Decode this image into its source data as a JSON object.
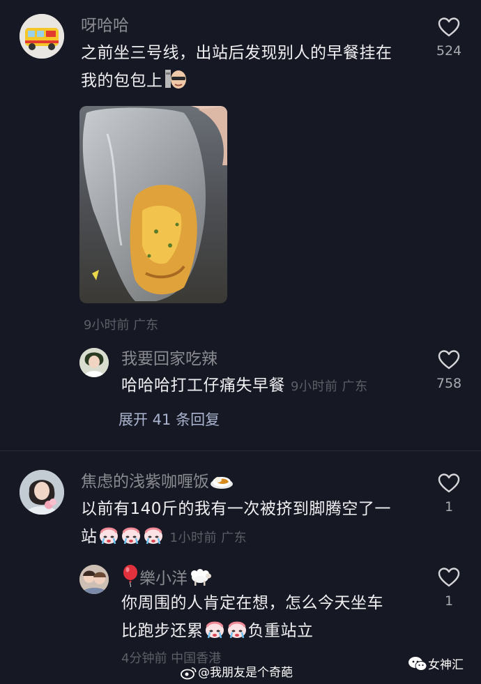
{
  "comments": [
    {
      "username": "呀哈哈",
      "text_lines": [
        "之前坐三号线，出站后发现别人的早餐挂在",
        "我的包包上"
      ],
      "time_location": "9小时前 广东",
      "likes": "524"
    },
    {
      "username": "焦虑的浅紫咖喱饭",
      "text_lines": [
        "以前有140斤的我有一次被挤到脚腾空了一",
        "站"
      ],
      "time_location": "1小时前 广东",
      "likes": "1"
    }
  ],
  "replies": [
    {
      "username": "我要回家吃辣",
      "text": "哈哈哈打工仔痛失早餐",
      "time_location": "9小时前 广东",
      "likes": "758"
    },
    {
      "username": "樂小洋",
      "text_lines": [
        "你周围的人肯定在想，怎么今天坐车",
        "比跑步还累",
        "负重站立"
      ],
      "time_location": "4分钟前 中国香港",
      "likes": "1"
    }
  ],
  "expand_replies": "展开 41 条回复",
  "watermark": {
    "weibo": "@我朋友是个奇葩",
    "wechat": "女神汇"
  },
  "colors": {
    "background": "#161823",
    "username": "#8a8b91",
    "meta": "#5d5f67",
    "expand": "#aab4cf"
  }
}
